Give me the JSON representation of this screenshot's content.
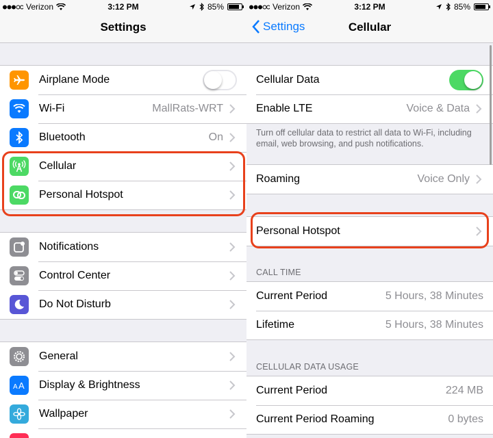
{
  "status": {
    "carrier": "Verizon",
    "time": "3:12 PM",
    "battery": "85%",
    "battery_level": 0.85
  },
  "left": {
    "title": "Settings",
    "group1": [
      {
        "label": "Airplane Mode",
        "icon": "airplane-icon",
        "color": "#ff9500",
        "control": "toggle",
        "state": "off"
      },
      {
        "label": "Wi-Fi",
        "icon": "wifi-icon",
        "color": "#0a7aff",
        "value": "MallRats-WRT"
      },
      {
        "label": "Bluetooth",
        "icon": "bluetooth-icon",
        "color": "#0a7aff",
        "value": "On"
      },
      {
        "label": "Cellular",
        "icon": "cellular-icon",
        "color": "#4cd964",
        "value": ""
      },
      {
        "label": "Personal Hotspot",
        "icon": "hotspot-icon",
        "color": "#4cd964",
        "value": ""
      }
    ],
    "group2": [
      {
        "label": "Notifications",
        "icon": "notifications-icon",
        "color": "#8e8e93"
      },
      {
        "label": "Control Center",
        "icon": "control-center-icon",
        "color": "#8e8e93"
      },
      {
        "label": "Do Not Disturb",
        "icon": "moon-icon",
        "color": "#5856d6"
      }
    ],
    "group3": [
      {
        "label": "General",
        "icon": "gear-icon",
        "color": "#8e8e93"
      },
      {
        "label": "Display & Brightness",
        "icon": "display-icon",
        "color": "#0a7aff"
      },
      {
        "label": "Wallpaper",
        "icon": "wallpaper-icon",
        "color": "#34aadc"
      }
    ]
  },
  "right": {
    "back_label": "Settings",
    "title": "Cellular",
    "cellular_data_label": "Cellular Data",
    "cellular_data_state": "on",
    "enable_lte_label": "Enable LTE",
    "enable_lte_value": "Voice & Data",
    "footer": "Turn off cellular data to restrict all data to Wi-Fi, including email, web browsing, and push notifications.",
    "roaming_label": "Roaming",
    "roaming_value": "Voice Only",
    "hotspot_label": "Personal Hotspot",
    "call_time_header": "CALL TIME",
    "call_time": [
      {
        "label": "Current Period",
        "value": "5 Hours, 38 Minutes"
      },
      {
        "label": "Lifetime",
        "value": "5 Hours, 38 Minutes"
      }
    ],
    "usage_header": "CELLULAR DATA USAGE",
    "usage": [
      {
        "label": "Current Period",
        "value": "224 MB"
      },
      {
        "label": "Current Period Roaming",
        "value": "0 bytes"
      }
    ]
  },
  "colors": {
    "accent": "#0a7aff",
    "toggle_on": "#4cd964",
    "highlight": "#e8411c"
  }
}
